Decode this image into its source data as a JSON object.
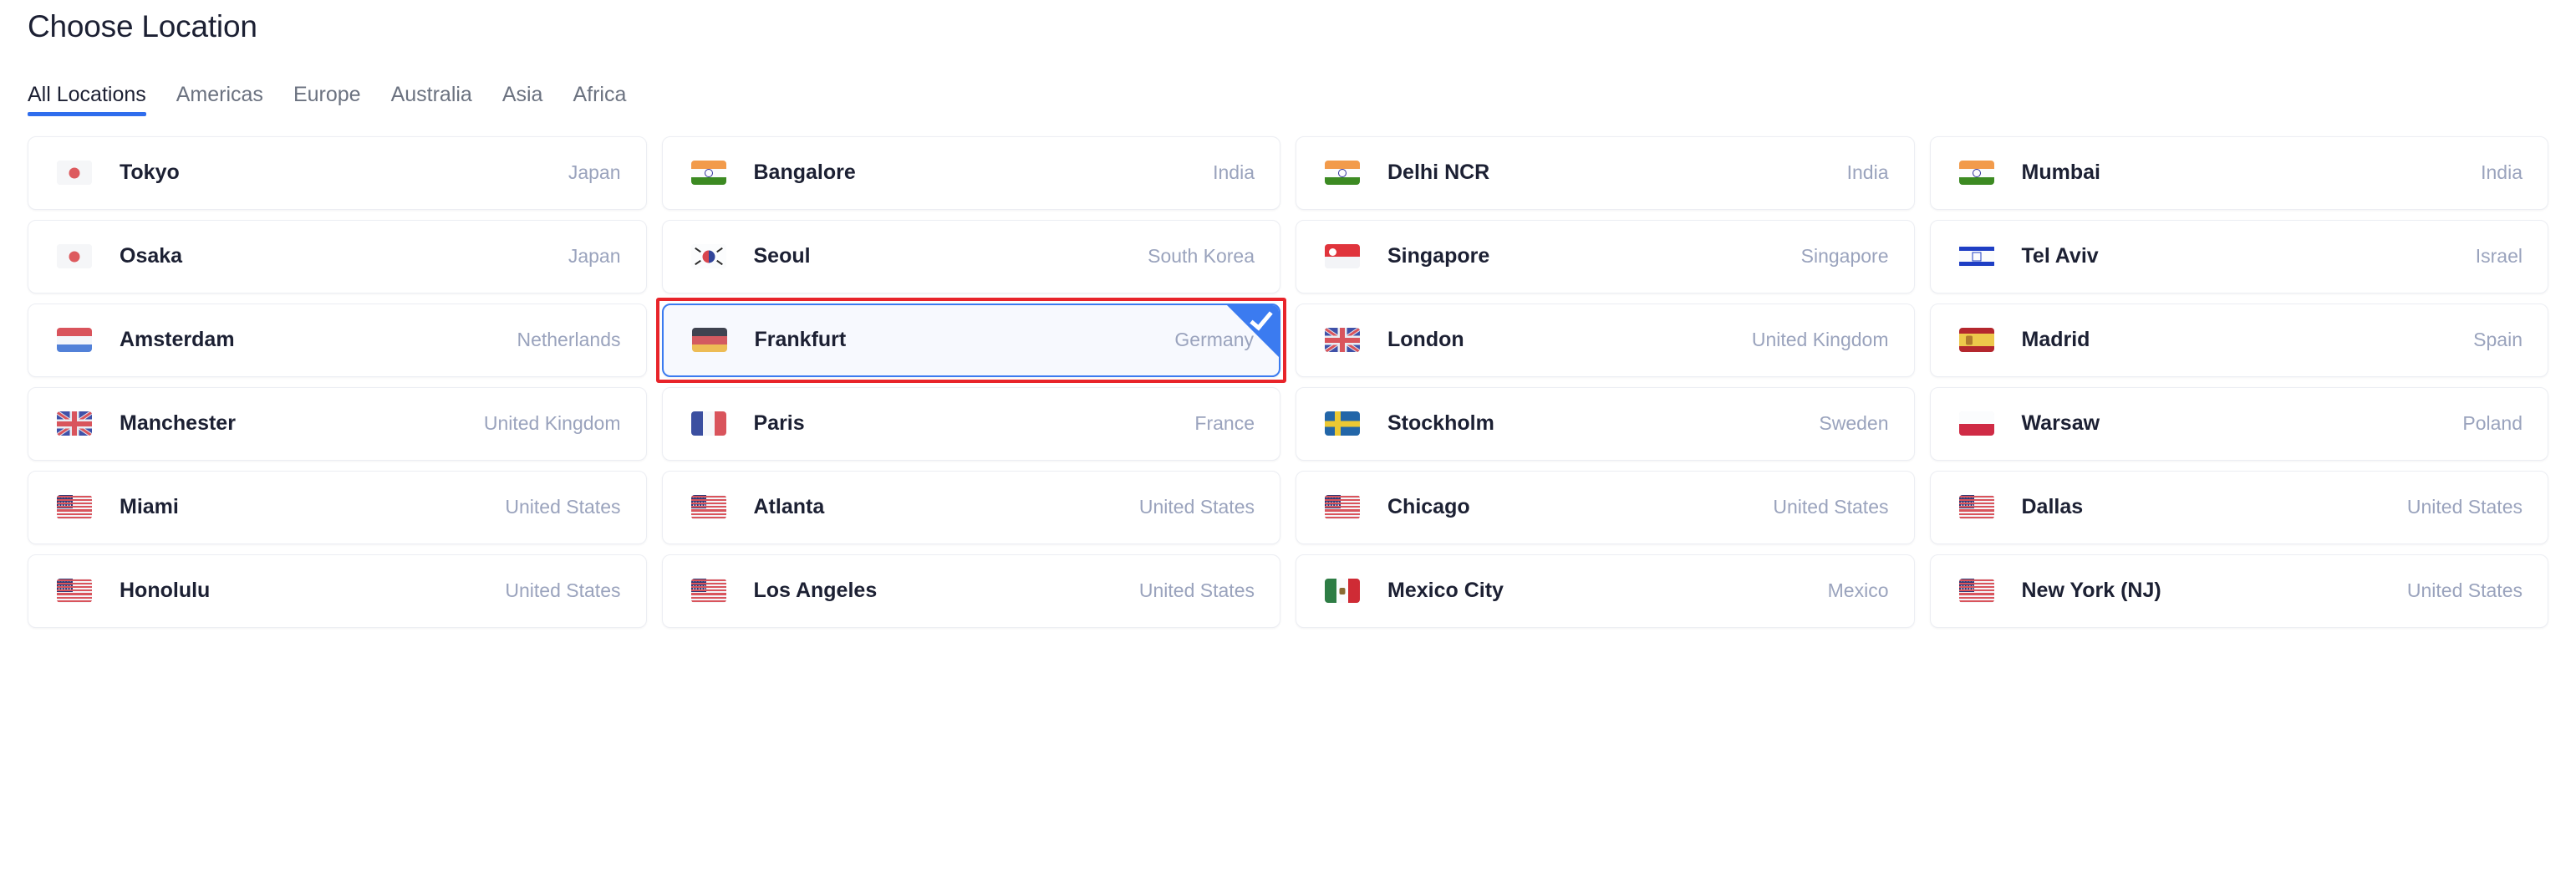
{
  "header": {
    "title": "Choose Location"
  },
  "tabs": {
    "items": [
      {
        "label": "All Locations",
        "active": true
      },
      {
        "label": "Americas",
        "active": false
      },
      {
        "label": "Europe",
        "active": false
      },
      {
        "label": "Australia",
        "active": false
      },
      {
        "label": "Asia",
        "active": false
      },
      {
        "label": "Africa",
        "active": false
      }
    ],
    "active_index": 0,
    "underline_color": "#2f6ded"
  },
  "colors": {
    "accent": "#2f6ded",
    "selected_border": "#3b7bf0",
    "selected_bg": "#f7f9fe",
    "annotation_red": "#e8242a",
    "city_text": "#1c2033",
    "country_text": "#9aa3bd",
    "card_border": "#eceef3"
  },
  "selection": {
    "selected_city": "Frankfurt",
    "check_icon": "check-icon",
    "annotated": true
  },
  "locations": [
    {
      "city": "Tokyo",
      "country": "Japan",
      "flag": "flag-jp",
      "selected": false
    },
    {
      "city": "Bangalore",
      "country": "India",
      "flag": "flag-in",
      "selected": false
    },
    {
      "city": "Delhi NCR",
      "country": "India",
      "flag": "flag-in",
      "selected": false
    },
    {
      "city": "Mumbai",
      "country": "India",
      "flag": "flag-in",
      "selected": false
    },
    {
      "city": "Osaka",
      "country": "Japan",
      "flag": "flag-jp",
      "selected": false
    },
    {
      "city": "Seoul",
      "country": "South Korea",
      "flag": "flag-kr",
      "selected": false
    },
    {
      "city": "Singapore",
      "country": "Singapore",
      "flag": "flag-sg",
      "selected": false
    },
    {
      "city": "Tel Aviv",
      "country": "Israel",
      "flag": "flag-il",
      "selected": false
    },
    {
      "city": "Amsterdam",
      "country": "Netherlands",
      "flag": "flag-nl",
      "selected": false
    },
    {
      "city": "Frankfurt",
      "country": "Germany",
      "flag": "flag-de",
      "selected": true
    },
    {
      "city": "London",
      "country": "United Kingdom",
      "flag": "flag-gb",
      "selected": false
    },
    {
      "city": "Madrid",
      "country": "Spain",
      "flag": "flag-es",
      "selected": false
    },
    {
      "city": "Manchester",
      "country": "United Kingdom",
      "flag": "flag-gb",
      "selected": false
    },
    {
      "city": "Paris",
      "country": "France",
      "flag": "flag-fr",
      "selected": false
    },
    {
      "city": "Stockholm",
      "country": "Sweden",
      "flag": "flag-se",
      "selected": false
    },
    {
      "city": "Warsaw",
      "country": "Poland",
      "flag": "flag-pl",
      "selected": false
    },
    {
      "city": "Miami",
      "country": "United States",
      "flag": "flag-us",
      "selected": false
    },
    {
      "city": "Atlanta",
      "country": "United States",
      "flag": "flag-us",
      "selected": false
    },
    {
      "city": "Chicago",
      "country": "United States",
      "flag": "flag-us",
      "selected": false
    },
    {
      "city": "Dallas",
      "country": "United States",
      "flag": "flag-us",
      "selected": false
    },
    {
      "city": "Honolulu",
      "country": "United States",
      "flag": "flag-us",
      "selected": false
    },
    {
      "city": "Los Angeles",
      "country": "United States",
      "flag": "flag-us",
      "selected": false
    },
    {
      "city": "Mexico City",
      "country": "Mexico",
      "flag": "flag-mx",
      "selected": false
    },
    {
      "city": "New York (NJ)",
      "country": "United States",
      "flag": "flag-us",
      "selected": false
    }
  ]
}
